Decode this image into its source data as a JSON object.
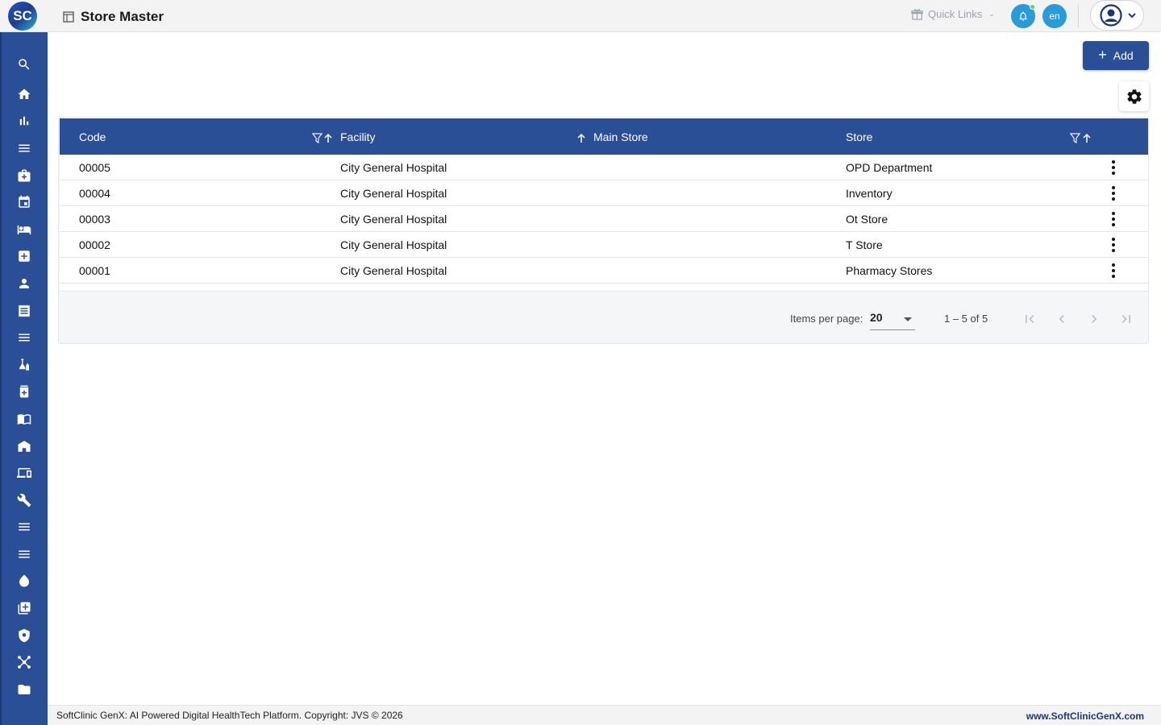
{
  "header": {
    "logo_text": "SC",
    "page_title": "Store Master",
    "quick_links_label": "Quick Links",
    "lang_label": "en"
  },
  "sidebar": {
    "icons": [
      "search-icon",
      "home-icon",
      "bar-chart-icon",
      "menu-icon",
      "medical-bag-icon",
      "calendar-icon",
      "bed-icon",
      "medical-plus-icon",
      "person-icon",
      "receipt-icon",
      "list-icon",
      "lab-icon",
      "pharmacy-bottle-icon",
      "book-icon",
      "store-icon",
      "devices-icon",
      "wrench-icon",
      "menu-icon",
      "menu-icon",
      "blood-drop-icon",
      "add-library-icon",
      "shield-icon",
      "hub-icon",
      "folder-icon"
    ]
  },
  "toolbar": {
    "add_label": "Add"
  },
  "table": {
    "columns": {
      "code": "Code",
      "facility": "Facility",
      "main_store": "Main Store",
      "store": "Store"
    },
    "rows": [
      {
        "code": "00005",
        "facility": "City General Hospital",
        "main_store": "",
        "store": "OPD Department"
      },
      {
        "code": "00004",
        "facility": "City General Hospital",
        "main_store": "",
        "store": "Inventory"
      },
      {
        "code": "00003",
        "facility": "City General Hospital",
        "main_store": "",
        "store": "Ot Store"
      },
      {
        "code": "00002",
        "facility": "City General Hospital",
        "main_store": "",
        "store": "T Store"
      },
      {
        "code": "00001",
        "facility": "City General Hospital",
        "main_store": "",
        "store": "Pharmacy Stores"
      }
    ]
  },
  "paginator": {
    "items_per_page_label": "Items per page:",
    "items_per_page_value": "20",
    "range_label": "1 – 5 of 5"
  },
  "footer": {
    "copyright": "SoftClinic GenX: AI Powered Digital HealthTech Platform. Copyright: JVS © 2026",
    "site": "www.SoftClinicGenX.com"
  },
  "colors": {
    "primary": "#2a4f96",
    "accent": "#2a9ad9",
    "notification_dot": "#4cd964"
  }
}
